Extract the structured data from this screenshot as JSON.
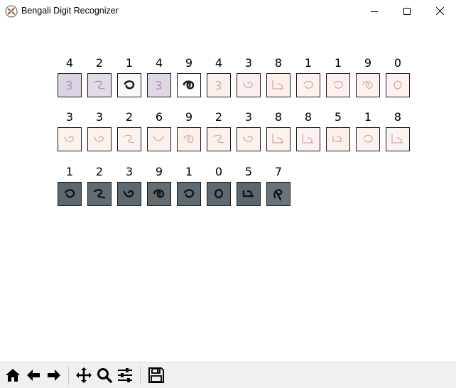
{
  "window": {
    "title": "Bengali Digit Recognizer",
    "controls": [
      "minimize-icon",
      "maximize-icon",
      "close-icon"
    ]
  },
  "figure": {
    "rows": [
      {
        "labels": [
          "4",
          "2",
          "1",
          "4",
          "9",
          "4",
          "3",
          "8",
          "1",
          "1",
          "9",
          "0"
        ],
        "tile_colors": [
          "#dcd3e2",
          "#e2dae6",
          "#f9f7fa",
          "#dfd7e3",
          "#ffffff",
          "#fbf0ee",
          "#fbeeee",
          "#fcefec",
          "#fdf2ef",
          "#fdf1ef",
          "#fdf1ee",
          "#fdf2ef"
        ]
      },
      {
        "labels": [
          "3",
          "3",
          "2",
          "6",
          "9",
          "2",
          "3",
          "8",
          "8",
          "5",
          "1",
          "8"
        ],
        "tile_colors": [
          "#fcf2ee",
          "#fcf1ec",
          "#fcf2ef",
          "#fbf0eb",
          "#fcf0ec",
          "#fcf1ee",
          "#fcf2ef",
          "#fcf2ef",
          "#fcf2ef",
          "#fcf0ec",
          "#fcf1ee",
          "#fcf2ef"
        ]
      },
      {
        "labels": [
          "1",
          "2",
          "3",
          "9",
          "1",
          "0",
          "5",
          "7"
        ],
        "tile_colors": [
          "#5c6770",
          "#616b73",
          "#5d6870",
          "#616c74",
          "#5f6a72",
          "#5e6971",
          "#5b666e",
          "#6a737b"
        ]
      }
    ]
  },
  "toolbar": {
    "buttons": [
      "home-icon",
      "back-icon",
      "forward-icon",
      "pan-icon",
      "zoom-icon",
      "configure-subplots-icon",
      "save-icon"
    ]
  }
}
